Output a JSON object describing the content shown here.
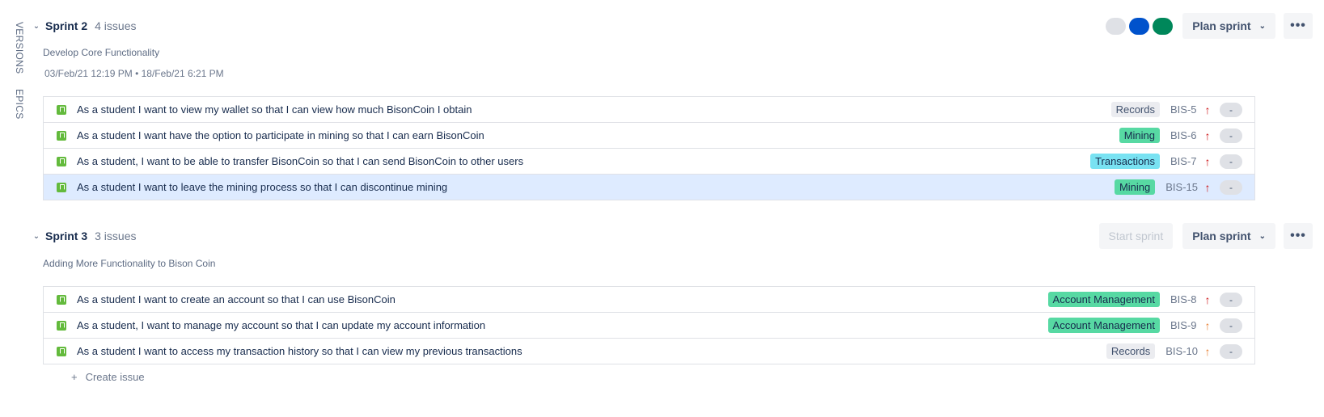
{
  "side_tabs": {
    "versions": "VERSIONS",
    "epics": "EPICS"
  },
  "sprints": [
    {
      "name": "Sprint 2",
      "issue_count": "4 issues",
      "goal": "Develop Core Functionality",
      "dates": "03/Feb/21 12:19 PM • 18/Feb/21 6:21 PM",
      "status_dots": [
        "#dfe1e6",
        "#0052cc",
        "#00875a"
      ],
      "plan_label": "Plan sprint",
      "more_label": "•••",
      "issues": [
        {
          "summary": "As a student I want to view my wallet so that I can view how much BisonCoin I obtain",
          "epic": "Records",
          "key": "BIS-5",
          "priority": "highest",
          "estimate": "-"
        },
        {
          "summary": "As a student I want have the option to participate in mining so that I can earn BisonCoin",
          "epic": "Mining",
          "key": "BIS-6",
          "priority": "highest",
          "estimate": "-"
        },
        {
          "summary": "As a student, I want to be able to transfer BisonCoin so that I can send BisonCoin to other users",
          "epic": "Transactions",
          "key": "BIS-7",
          "priority": "highest",
          "estimate": "-"
        },
        {
          "summary": "As a student I want to leave the mining process so that I can discontinue mining",
          "epic": "Mining",
          "key": "BIS-15",
          "priority": "highest",
          "estimate": "-"
        }
      ]
    },
    {
      "name": "Sprint 3",
      "issue_count": "3 issues",
      "goal": "Adding More Functionality to Bison Coin",
      "start_label": "Start sprint",
      "plan_label": "Plan sprint",
      "more_label": "•••",
      "issues": [
        {
          "summary": "As a student I want to create an account so that I can use BisonCoin",
          "epic": "Account Management",
          "key": "BIS-8",
          "priority": "highest",
          "estimate": "-"
        },
        {
          "summary": "As a student, I want to manage my account so that I can update my account information",
          "epic": "Account Management",
          "key": "BIS-9",
          "priority": "high",
          "estimate": "-"
        },
        {
          "summary": "As a student I want to access my transaction history so that I can view my previous transactions",
          "epic": "Records",
          "key": "BIS-10",
          "priority": "high",
          "estimate": "-"
        }
      ]
    }
  ],
  "create_issue": {
    "plus": "+",
    "label": "Create issue"
  },
  "icons": {
    "priority_arrow": "↑",
    "chevron": "⌄",
    "caret": "⌄"
  }
}
